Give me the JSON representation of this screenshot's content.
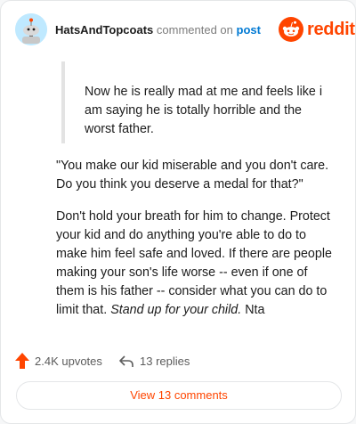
{
  "comment": {
    "author": "HatsAndTopcoats",
    "action_text": "commented on",
    "post_link": "post",
    "brand": "reddit",
    "quote": "Now he is really mad at me and feels like i am saying he is totally horrible and the worst father.",
    "paragraph_1": "\"You make our kid miserable and you don't care. Do you think you deserve a medal for that?\"",
    "paragraph_2_text": "Don't hold your breath for him to change. Protect your kid and do anything you're able to do to make him feel safe and loved. If there are people making your son's life worse -- even if one of them is his father -- consider what you can do to limit that. ",
    "paragraph_2_italic": "Stand up for your child.",
    "paragraph_2_tail": " Nta"
  },
  "footer": {
    "upvotes": "2.4K upvotes",
    "replies": "13 replies",
    "view_button": "View 13 comments"
  },
  "colors": {
    "brand": "#ff4500",
    "link": "#0079d3"
  },
  "icons": [
    "snoo-avatar-icon",
    "reddit-logo-icon",
    "upvote-arrow-icon",
    "reply-arrow-icon"
  ]
}
